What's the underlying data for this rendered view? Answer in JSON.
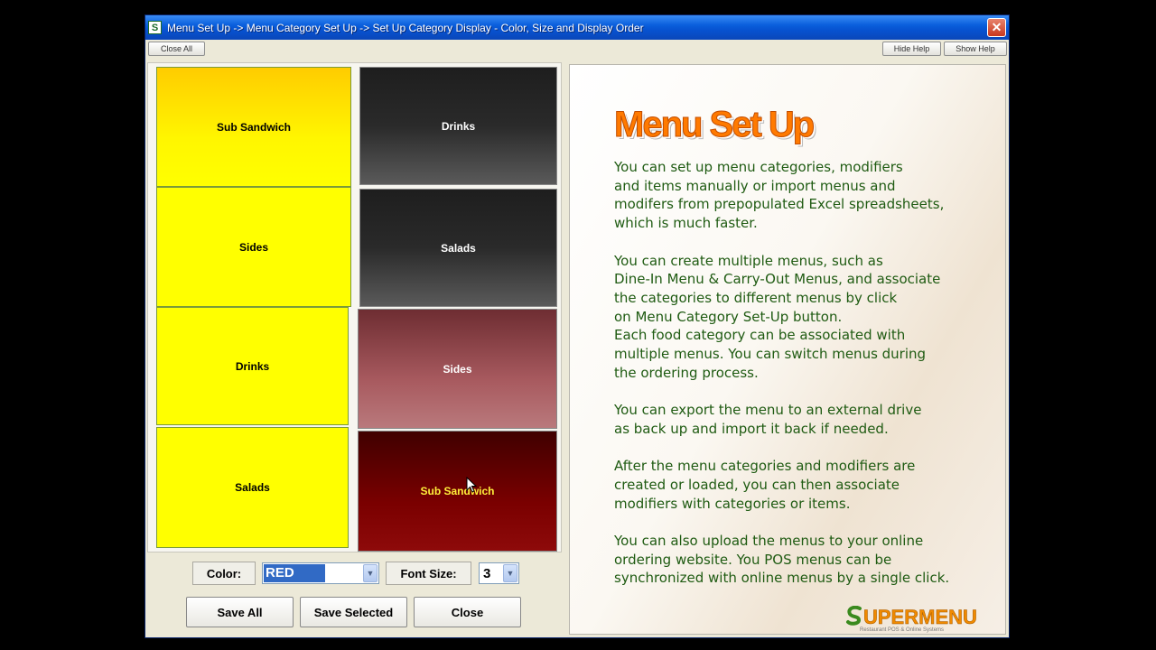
{
  "window": {
    "title": "Menu Set Up -> Menu Category Set Up -> Set Up Category Display - Color, Size and Display Order",
    "app_icon_glyph": "S",
    "close_glyph": "✕"
  },
  "toolbar": {
    "close_all": "Close All",
    "hide_help": "Hide Help",
    "show_help": "Show Help"
  },
  "left_tiles": [
    "Sub Sandwich",
    "Sides",
    "Drinks",
    "Salads"
  ],
  "right_tiles": [
    "Drinks",
    "Salads",
    "Sides",
    "Sub Sandwich"
  ],
  "controls": {
    "color_label": "Color:",
    "color_value": "RED",
    "font_size_label": "Font Size:",
    "font_size_value": "3",
    "dropdown_glyph": "▼",
    "save_all": "Save All",
    "save_selected": "Save Selected",
    "close": "Close"
  },
  "help": {
    "title": "Menu Set Up",
    "paragraphs": [
      "You can set up menu categories, modifiers\nand items manually or import menus and\nmodifers from prepopulated Excel spreadsheets,\nwhich is much faster.",
      "You can create multiple menus, such as\nDine-In Menu & Carry-Out Menus, and associate\nthe categories to different menus by click\non Menu Category Set-Up button.\nEach food category can be associated with\nmultiple menus. You can switch menus during\nthe ordering process.",
      "You can export the menu to an external drive\nas back up and import it back if needed.",
      "After the menu categories and modifiers are\ncreated or loaded, you can then associate\nmodifiers with categories or items.",
      "You can also upload the menus to your online\nordering website. You POS menus can be\nsynchronized with online menus by a single click."
    ],
    "logo_text": "UPERMENU",
    "logo_tagline": "Restaurant POS & Online Systems"
  },
  "colors": {
    "title_orange": "#ff7a00",
    "body_green": "#1f5b12",
    "selected_highlight": "#316ac5"
  }
}
